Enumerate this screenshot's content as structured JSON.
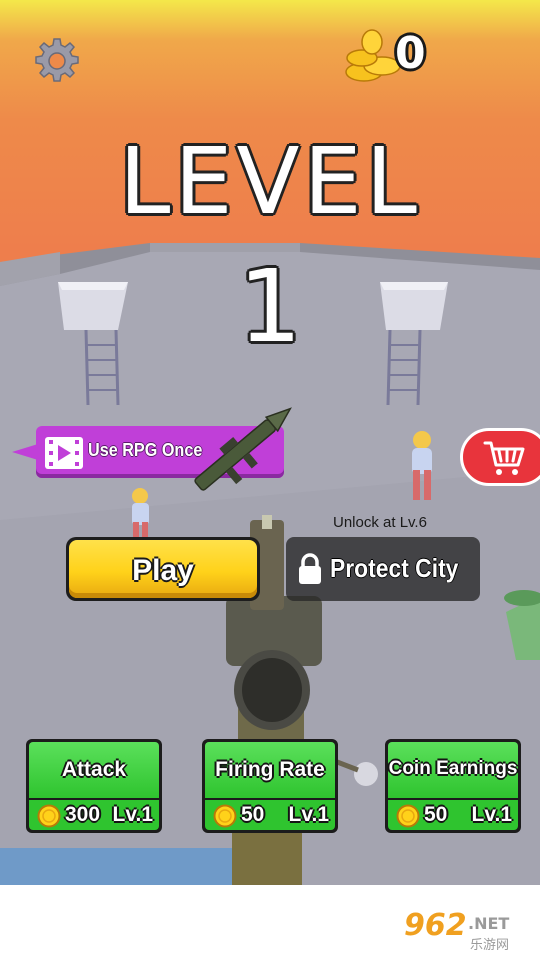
{
  "hud": {
    "settings_icon": "gear-icon",
    "coin_icon": "coin-stack-icon",
    "coin_count": "0"
  },
  "level": {
    "title": "LEVEL",
    "number": "1"
  },
  "rpg_offer": {
    "label": "Use RPG Once",
    "icon": "video-ad-icon"
  },
  "shop": {
    "icon": "shopping-cart-icon",
    "color": "#e8343c"
  },
  "modes": {
    "play_label": "Play",
    "protect_label": "Protect City",
    "protect_unlock": "Unlock at Lv.6",
    "lock_icon": "lock-icon"
  },
  "upgrades": [
    {
      "title": "Attack",
      "cost": "300",
      "level": "Lv.1"
    },
    {
      "title": "Firing Rate",
      "cost": "50",
      "level": "Lv.1"
    },
    {
      "title": "Coin Earnings",
      "cost": "50",
      "level": "Lv.1"
    }
  ],
  "watermark": {
    "number": "962",
    "net": ".NET",
    "cn": "乐游网"
  },
  "colors": {
    "play_yellow": "#ffd21a",
    "upgrade_green": "#2fc42f",
    "rpg_purple": "#c03fd8"
  }
}
